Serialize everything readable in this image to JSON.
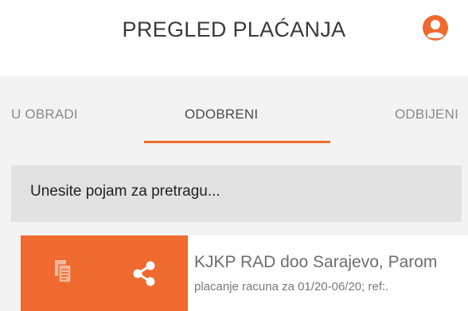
{
  "header": {
    "title": "PREGLED PLAĆANJA",
    "profile_icon": "user-circle-icon",
    "accent": "#ee6a2e"
  },
  "tabs": [
    {
      "label": "U OBRADI",
      "active": false
    },
    {
      "label": "ODOBRENI",
      "active": true
    },
    {
      "label": "ODBIJENI",
      "active": false
    }
  ],
  "search": {
    "placeholder": "Unesite pojam za pretragu..."
  },
  "payments": [
    {
      "title": "KJKP RAD doo Sarajevo, Parom",
      "description": "placanje racuna za 01/20-06/20; ref:.",
      "actions": [
        "copy-document-icon",
        "share-icon"
      ]
    }
  ]
}
